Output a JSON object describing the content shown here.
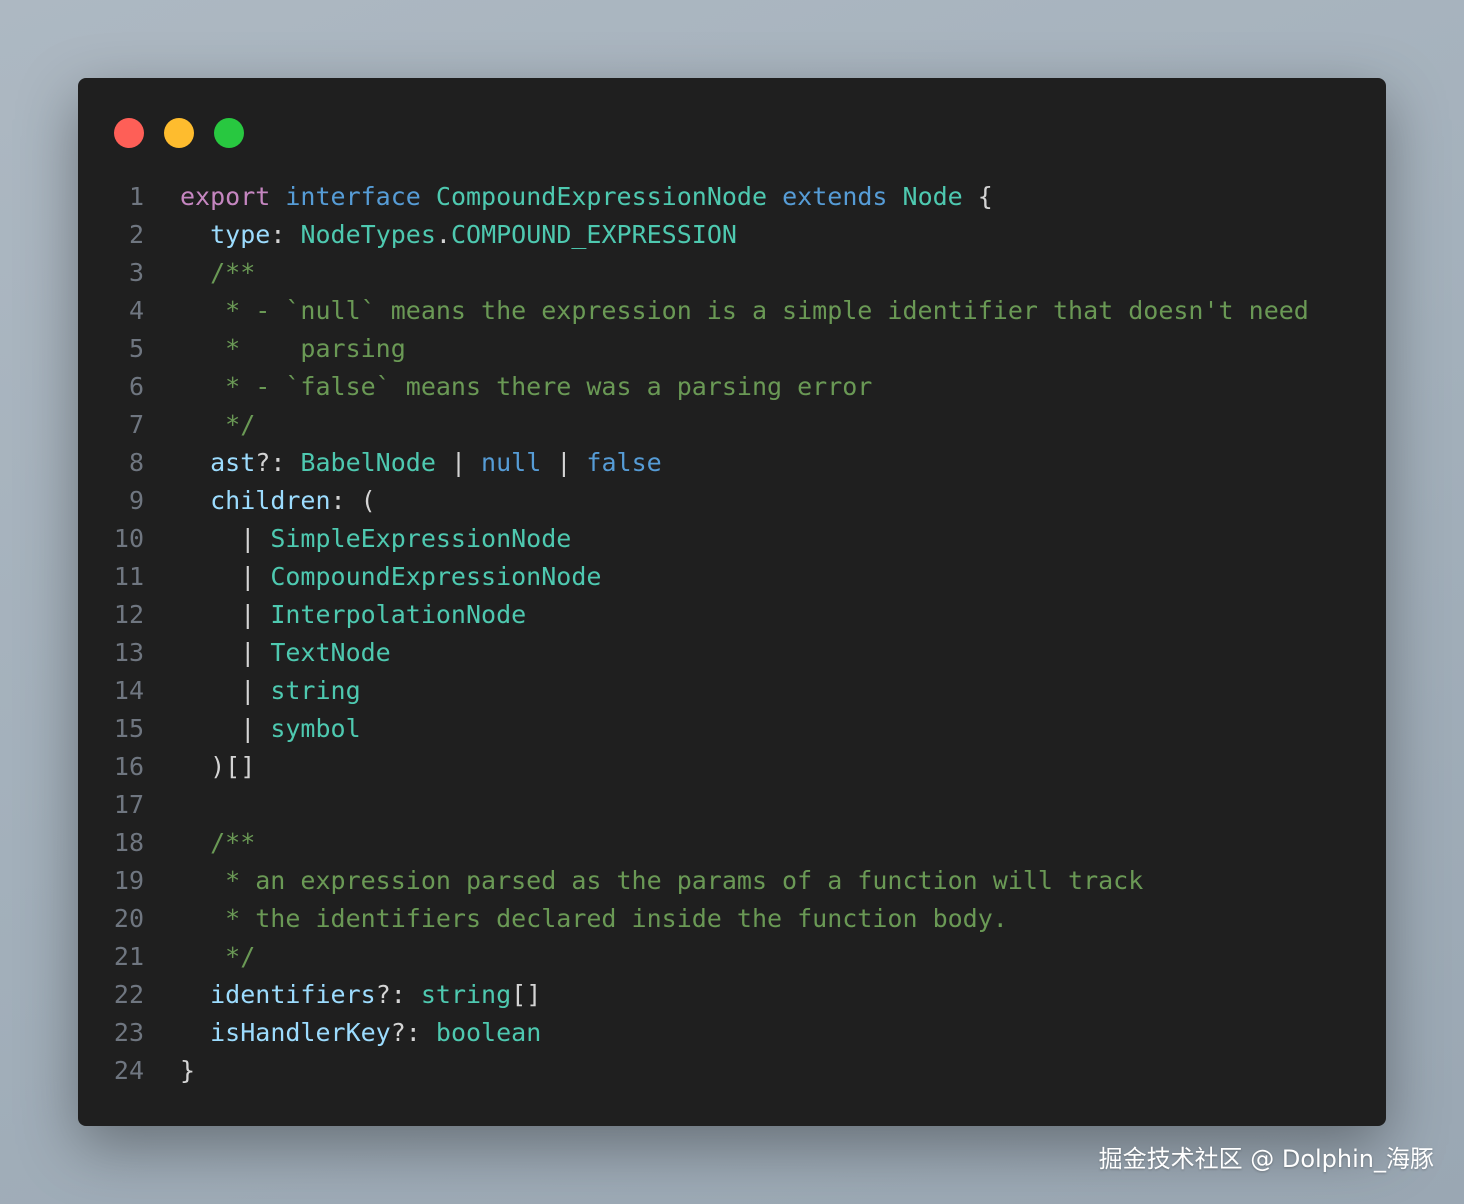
{
  "window": {
    "traffic_lights": [
      {
        "name": "close",
        "color": "#fe5f57"
      },
      {
        "name": "minimize",
        "color": "#febc2e"
      },
      {
        "name": "maximize",
        "color": "#28c840"
      }
    ]
  },
  "code": {
    "lines": [
      {
        "n": "1",
        "tokens": [
          [
            "export",
            "pink"
          ],
          [
            " ",
            "punc"
          ],
          [
            "interface",
            "blue"
          ],
          [
            " ",
            "punc"
          ],
          [
            "CompoundExpressionNode",
            "teal"
          ],
          [
            " ",
            "punc"
          ],
          [
            "extends",
            "blue"
          ],
          [
            " ",
            "punc"
          ],
          [
            "Node",
            "teal"
          ],
          [
            " {",
            "punc"
          ]
        ]
      },
      {
        "n": "2",
        "tokens": [
          [
            "  ",
            "punc"
          ],
          [
            "type",
            "prop"
          ],
          [
            ": ",
            "punc"
          ],
          [
            "NodeTypes",
            "teal"
          ],
          [
            ".",
            "punc"
          ],
          [
            "COMPOUND_EXPRESSION",
            "teal"
          ]
        ]
      },
      {
        "n": "3",
        "tokens": [
          [
            "  /**",
            "comment"
          ]
        ]
      },
      {
        "n": "4",
        "tokens": [
          [
            "   * - `null` means the expression is a simple identifier that doesn't need",
            "comment"
          ]
        ]
      },
      {
        "n": "5",
        "tokens": [
          [
            "   *    parsing",
            "comment"
          ]
        ]
      },
      {
        "n": "6",
        "tokens": [
          [
            "   * - `false` means there was a parsing error",
            "comment"
          ]
        ]
      },
      {
        "n": "7",
        "tokens": [
          [
            "   */",
            "comment"
          ]
        ]
      },
      {
        "n": "8",
        "tokens": [
          [
            "  ",
            "punc"
          ],
          [
            "ast",
            "prop"
          ],
          [
            "?: ",
            "punc"
          ],
          [
            "BabelNode",
            "teal"
          ],
          [
            " | ",
            "punc"
          ],
          [
            "null",
            "blue"
          ],
          [
            " | ",
            "punc"
          ],
          [
            "false",
            "blue"
          ]
        ]
      },
      {
        "n": "9",
        "tokens": [
          [
            "  ",
            "punc"
          ],
          [
            "children",
            "prop"
          ],
          [
            ": (",
            "punc"
          ]
        ]
      },
      {
        "n": "10",
        "tokens": [
          [
            "    | ",
            "punc"
          ],
          [
            "SimpleExpressionNode",
            "teal"
          ]
        ]
      },
      {
        "n": "11",
        "tokens": [
          [
            "    | ",
            "punc"
          ],
          [
            "CompoundExpressionNode",
            "teal"
          ]
        ]
      },
      {
        "n": "12",
        "tokens": [
          [
            "    | ",
            "punc"
          ],
          [
            "InterpolationNode",
            "teal"
          ]
        ]
      },
      {
        "n": "13",
        "tokens": [
          [
            "    | ",
            "punc"
          ],
          [
            "TextNode",
            "teal"
          ]
        ]
      },
      {
        "n": "14",
        "tokens": [
          [
            "    | ",
            "punc"
          ],
          [
            "string",
            "teal"
          ]
        ]
      },
      {
        "n": "15",
        "tokens": [
          [
            "    | ",
            "punc"
          ],
          [
            "symbol",
            "teal"
          ]
        ]
      },
      {
        "n": "16",
        "tokens": [
          [
            "  )[]",
            "punc"
          ]
        ]
      },
      {
        "n": "17",
        "tokens": []
      },
      {
        "n": "18",
        "tokens": [
          [
            "  /**",
            "comment"
          ]
        ]
      },
      {
        "n": "19",
        "tokens": [
          [
            "   * an expression parsed as the params of a function will track",
            "comment"
          ]
        ]
      },
      {
        "n": "20",
        "tokens": [
          [
            "   * the identifiers declared inside the function body.",
            "comment"
          ]
        ]
      },
      {
        "n": "21",
        "tokens": [
          [
            "   */",
            "comment"
          ]
        ]
      },
      {
        "n": "22",
        "tokens": [
          [
            "  ",
            "punc"
          ],
          [
            "identifiers",
            "prop"
          ],
          [
            "?: ",
            "punc"
          ],
          [
            "string",
            "teal"
          ],
          [
            "[]",
            "punc"
          ]
        ]
      },
      {
        "n": "23",
        "tokens": [
          [
            "  ",
            "punc"
          ],
          [
            "isHandlerKey",
            "prop"
          ],
          [
            "?: ",
            "punc"
          ],
          [
            "boolean",
            "teal"
          ]
        ]
      },
      {
        "n": "24",
        "tokens": [
          [
            "}",
            "punc"
          ]
        ]
      }
    ]
  },
  "watermark": "掘金技术社区 @ Dolphin_海豚"
}
